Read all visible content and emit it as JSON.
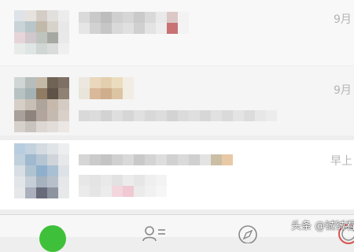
{
  "chats": [
    {
      "time": "9月"
    },
    {
      "time": "9月"
    },
    {
      "time": "早上"
    }
  ],
  "tabbar": {
    "chat_color": "#3fc03a",
    "icons": [
      "chat-icon",
      "contacts-icon",
      "discover-icon",
      "me-icon"
    ]
  },
  "watermark": "头条 @铖铖看"
}
